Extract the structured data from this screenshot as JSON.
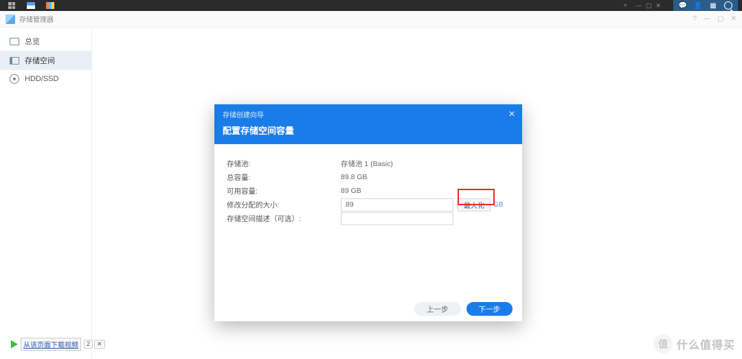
{
  "taskbar": {
    "plus": "+",
    "win": {
      "min": "—",
      "max": "▢",
      "close": "✕"
    }
  },
  "app": {
    "title": "存储管理器",
    "win": {
      "help": "?",
      "min": "—",
      "max": "▢",
      "close": "✕"
    }
  },
  "sidebar": {
    "items": [
      {
        "label": "总览"
      },
      {
        "label": "存储空间"
      },
      {
        "label": "HDD/SSD"
      }
    ]
  },
  "dialog": {
    "breadcrumb": "存储创建向导",
    "title": "配置存储空间容量",
    "close": "✕",
    "fields": {
      "pool_label": "存储池:",
      "pool_value": "存储池 1 (Basic)",
      "total_label": "总容量:",
      "total_value": "89.8 GB",
      "avail_label": "可用容量:",
      "avail_value": "89 GB",
      "alloc_label": "修改分配的大小:",
      "alloc_value": "89",
      "alloc_unit": "GB",
      "max_button": "最大化",
      "desc_label": "存储空间描述（可选）:",
      "desc_value": ""
    },
    "footer": {
      "prev": "上一步",
      "next": "下一步"
    }
  },
  "download_bar": {
    "text": "从该页面下载视频",
    "badge1": "2",
    "badge2": "✕"
  },
  "watermark": {
    "logo": "值",
    "text": "什么值得买"
  }
}
